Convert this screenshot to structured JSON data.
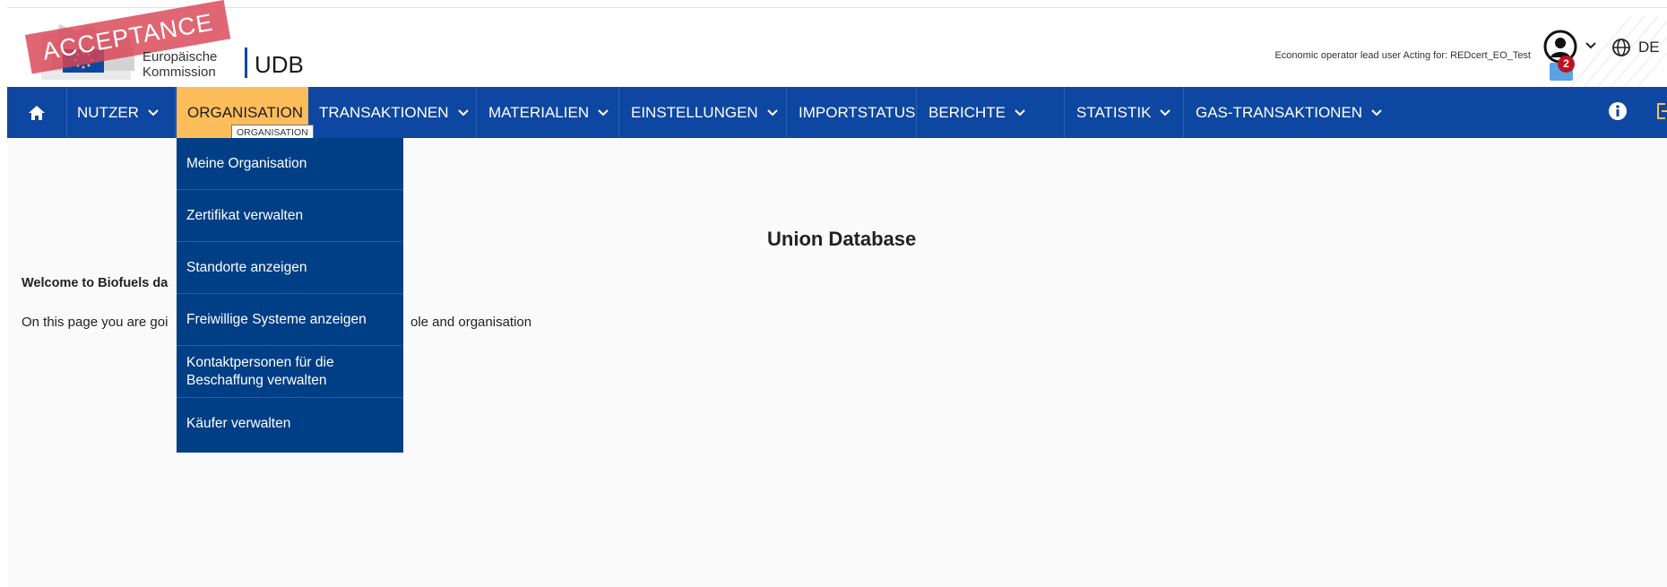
{
  "header": {
    "stamp_text": "ACCEPTANCE",
    "ec_line1": "Europäische",
    "ec_line2": "Kommission",
    "app_name": "UDB",
    "acting_text": "Economic operator lead user Acting for: REDcert_EO_Test",
    "notification_count": "2",
    "language": "DE"
  },
  "nav": {
    "items": [
      {
        "label": "NUTZER",
        "has_menu": true
      },
      {
        "label": "ORGANISATION",
        "has_menu": true,
        "active": true
      },
      {
        "label": "TRANSAKTIONEN",
        "has_menu": true
      },
      {
        "label": "MATERIALIEN",
        "has_menu": true
      },
      {
        "label": "EINSTELLUNGEN",
        "has_menu": true
      },
      {
        "label": "IMPORTSTATUS",
        "has_menu": false
      },
      {
        "label": "BERICHTE",
        "has_menu": true
      },
      {
        "label": "STATISTIK",
        "has_menu": true
      },
      {
        "label": "GAS-TRANSAKTIONEN",
        "has_menu": true
      }
    ],
    "tooltip": "ORGANISATION"
  },
  "dropdown": {
    "items": [
      {
        "label": "Meine Organisation"
      },
      {
        "label": "Zertifikat verwalten"
      },
      {
        "label": "Standorte anzeigen"
      },
      {
        "label": "Freiwillige Systeme anzeigen"
      },
      {
        "label": "Kontaktpersonen für die Beschaffung verwalten"
      },
      {
        "label": "Käufer verwalten"
      }
    ]
  },
  "main": {
    "title": "Union Database",
    "welcome": "Welcome to Biofuels da",
    "paragraph_left": "On this page you are goi",
    "paragraph_right": "ole and organisation"
  },
  "colors": {
    "nav_bg": "#0e47a1",
    "active_tab": "#fdbd5a",
    "dropdown_bg": "#003e85",
    "stamp": "#da4455",
    "badge": "#c01221"
  },
  "icons": [
    "home-icon",
    "chevron-down-icon",
    "user-circle-icon",
    "globe-icon",
    "info-icon",
    "logout-icon",
    "mail-icon"
  ]
}
